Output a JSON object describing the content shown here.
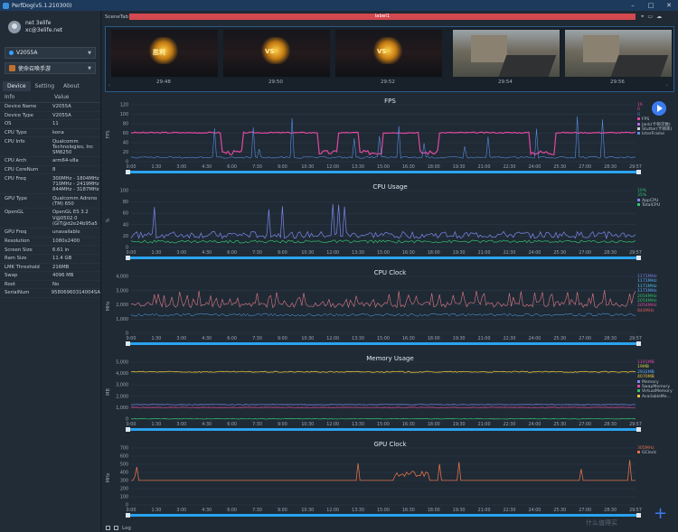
{
  "window": {
    "title": "PerfDog(v5.1.210300)",
    "buttons": [
      "–",
      "□",
      "✕"
    ]
  },
  "user": {
    "name": "net 3elife",
    "email": "xc@3elife.net"
  },
  "device_select": {
    "value": "V2055A"
  },
  "app_select": {
    "value": "使命召唤手游"
  },
  "tabs": [
    "Device",
    "Setting",
    "About"
  ],
  "info_header": {
    "key": "Info",
    "value": "Value"
  },
  "device_info": [
    {
      "k": "Device Name",
      "v": "V2055A"
    },
    {
      "k": "Device Type",
      "v": "V2055A"
    },
    {
      "k": "OS",
      "v": "11"
    },
    {
      "k": "CPU Type",
      "v": "kona"
    },
    {
      "k": "CPU Info",
      "v": "Qualcomm\nTechnologies, Inc\nSM8250"
    },
    {
      "k": "CPU Arch",
      "v": "arm64-v8a"
    },
    {
      "k": "CPU CoreNum",
      "v": "8"
    },
    {
      "k": "CPU Freq",
      "v": "300MHz - 1804MHz\n710MHz - 2419MHz\n844MHz - 3187MHz"
    },
    {
      "k": "GPU Type",
      "v": "Qualcomm Adreno\n(TM) 650"
    },
    {
      "k": "OpenGL",
      "v": "OpenGL ES 3.2\nV@0502.0\n(GIT@d2e24b95a5"
    },
    {
      "k": "GPU Freq",
      "v": "unavailable"
    },
    {
      "k": "Resolution",
      "v": "1080x2400"
    },
    {
      "k": "Screen Size",
      "v": "6.61 in"
    },
    {
      "k": "Ram Size",
      "v": "11.4 GB"
    },
    {
      "k": "LMK Threshold",
      "v": "216MB"
    },
    {
      "k": "Swap",
      "v": "4096 MB"
    },
    {
      "k": "Root",
      "v": "No"
    },
    {
      "k": "SerialNum",
      "v": "95806960314004SA"
    }
  ],
  "scene": {
    "label": "SceneTab",
    "tag": "label1"
  },
  "thumbnails": [
    {
      "time": "29:48",
      "kind": "victory",
      "text": "胜利"
    },
    {
      "time": "29:50",
      "kind": "vs",
      "text": "VS"
    },
    {
      "time": "29:52",
      "kind": "vs",
      "text": "VS"
    },
    {
      "time": "29:54",
      "kind": "fps",
      "text": ""
    },
    {
      "time": "29:56",
      "kind": "fps",
      "text": ""
    }
  ],
  "x_ticks": [
    "0:00",
    "1:30",
    "3:00",
    "4:30",
    "6:00",
    "7:30",
    "9:00",
    "10:30",
    "12:00",
    "13:30",
    "15:00",
    "16:30",
    "18:00",
    "19:30",
    "21:00",
    "22:30",
    "24:00",
    "25:30",
    "27:00",
    "28:30",
    "29:57"
  ],
  "charts": [
    {
      "title": "FPS",
      "ylabel": "FPS",
      "yticks": [
        "0",
        "20",
        "40",
        "60",
        "80",
        "100",
        "120"
      ],
      "ymax": 120,
      "legend_values": [
        {
          "text": "16",
          "color": "#e0489d"
        },
        {
          "text": "0",
          "color": "#e0489d"
        },
        {
          "text": "0",
          "color": "#5b8ce0"
        }
      ],
      "legend_items": [
        {
          "text": "FPS",
          "color": "#e0489d"
        },
        {
          "text": "Jank(卡顿次数)",
          "color": "#b36ae0"
        },
        {
          "text": "Stutter(卡顿率)",
          "color": "#d0d0d0"
        },
        {
          "text": "InterFrame",
          "color": "#5b8ce0"
        }
      ]
    },
    {
      "title": "CPU Usage",
      "ylabel": "%",
      "yticks": [
        "0",
        "20",
        "40",
        "60",
        "80",
        "100"
      ],
      "ymax": 100,
      "legend_values": [
        {
          "text": "10%",
          "color": "#35c06a"
        },
        {
          "text": "35%",
          "color": "#35c06a"
        }
      ],
      "legend_items": [
        {
          "text": "AppCPU",
          "color": "#7e86ea"
        },
        {
          "text": "TotalCPU",
          "color": "#35c06a"
        }
      ]
    },
    {
      "title": "CPU Clock",
      "ylabel": "MHz",
      "yticks": [
        "0",
        "1,000",
        "2,000",
        "3,000",
        "4,000"
      ],
      "ymax": 4000,
      "legend_values": [
        {
          "text": "1171MHz",
          "color": "#7e86ea"
        },
        {
          "text": "1171MHz",
          "color": "#5fb0ff"
        },
        {
          "text": "1171MHz",
          "color": "#4fc3e8"
        },
        {
          "text": "1171MHz",
          "color": "#5fb0ff"
        },
        {
          "text": "2054MHz",
          "color": "#35c06a"
        },
        {
          "text": "2054MHz",
          "color": "#35c06a"
        },
        {
          "text": "2054MHz",
          "color": "#e0489d"
        },
        {
          "text": "844MHz",
          "color": "#e05a5a"
        }
      ],
      "legend_items": []
    },
    {
      "title": "Memory Usage",
      "ylabel": "MB",
      "yticks": [
        "0",
        "1,000",
        "2,000",
        "3,000",
        "4,000",
        "5,000"
      ],
      "ymax": 5000,
      "legend_values": [
        {
          "text": "1191MB",
          "color": "#e0489d"
        },
        {
          "text": "19MB",
          "color": "#d0d040"
        },
        {
          "text": "2932MB",
          "color": "#5fb0ff"
        },
        {
          "text": "4070MB",
          "color": "#e8c23a"
        }
      ],
      "legend_items": [
        {
          "text": "Memory",
          "color": "#7e86ea"
        },
        {
          "text": "SwapMemory",
          "color": "#e0489d"
        },
        {
          "text": "VirtualMemory",
          "color": "#35c06a"
        },
        {
          "text": "AvailableMe…",
          "color": "#e8c23a"
        }
      ]
    },
    {
      "title": "GPU Clock",
      "ylabel": "MHz",
      "yticks": [
        "0",
        "100",
        "200",
        "300",
        "400",
        "500",
        "600",
        "700"
      ],
      "ymax": 700,
      "legend_values": [
        {
          "text": "305MHz",
          "color": "#e0704a"
        }
      ],
      "legend_items": [
        {
          "text": "GClock",
          "color": "#e0704a"
        }
      ]
    }
  ],
  "footer": {
    "log": "Log"
  },
  "watermark": "什么值得买"
}
